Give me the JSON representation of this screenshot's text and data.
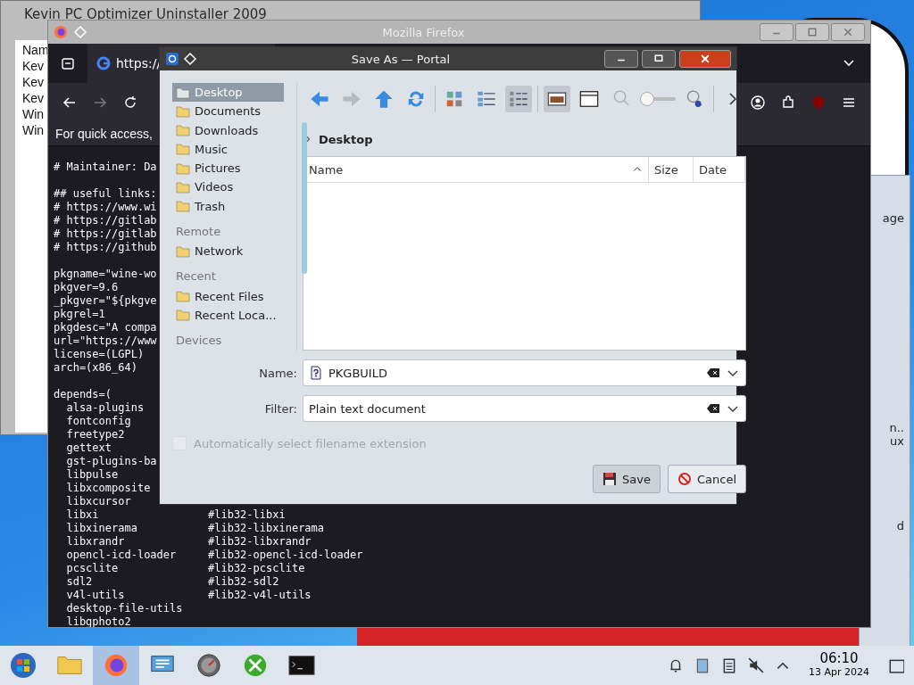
{
  "back_window": {
    "title": "Kevin PC Optimizer Uninstaller 2009",
    "list_items": [
      "Nam",
      "Kev",
      "Kev",
      "Kev",
      "Win",
      "Win"
    ]
  },
  "browser": {
    "title": "Mozilla Firefox",
    "tabs": [
      {
        "label": "https://",
        "selected": true
      }
    ],
    "notification": "For quick access,",
    "code_blocks": [
      [
        {
          "text": "# Maintainer: Da"
        }
      ],
      [
        {
          "text": "## useful links:"
        },
        {
          "text": "# https://www.wi"
        },
        {
          "text": "# https://gitlab"
        },
        {
          "text": "# https://gitlab"
        },
        {
          "text": "# https://github"
        }
      ],
      [
        {
          "text": "pkgname=\"wine-wo"
        },
        {
          "text": "pkgver=9.6"
        },
        {
          "text": "_pkgver=\"${pkgve"
        },
        {
          "text": "pkgrel=1"
        },
        {
          "text": "pkgdesc=\"A compa"
        },
        {
          "text": "url=\"https://www"
        },
        {
          "text": "license=(LGPL)"
        },
        {
          "text": "arch=(x86_64)"
        }
      ],
      [
        {
          "text": "depends=("
        },
        {
          "text": "  alsa-plugins"
        },
        {
          "text": "  fontconfig"
        },
        {
          "text": "  freetype2"
        },
        {
          "text": "  gettext"
        },
        {
          "text": "  gst-plugins-ba"
        },
        {
          "text": "  libpulse"
        },
        {
          "text": "  libxcomposite"
        },
        {
          "text": "  libxcursor"
        },
        {
          "text": "  libxi",
          "comment": "#lib32-libxi"
        },
        {
          "text": "  libxinerama",
          "comment": "#lib32-libxinerama"
        },
        {
          "text": "  libxrandr",
          "comment": "#lib32-libxrandr"
        },
        {
          "text": "  opencl-icd-loader",
          "comment": "#lib32-opencl-icd-loader"
        },
        {
          "text": "  pcsclite",
          "comment": "#lib32-pcsclite"
        },
        {
          "text": "  sdl2",
          "comment": "#lib32-sdl2"
        },
        {
          "text": "  v4l-utils",
          "comment": "#lib32-v4l-utils"
        },
        {
          "text": "  desktop-file-utils"
        },
        {
          "text": "  libgphoto2"
        }
      ]
    ]
  },
  "side_window": {
    "texts": [
      "age",
      "n..",
      "ux",
      "d"
    ]
  },
  "dialog": {
    "title": "Save As — Portal",
    "places": [
      {
        "kind": "item",
        "label": "Desktop",
        "selected": true
      },
      {
        "kind": "item",
        "label": "Documents",
        "selected": false
      },
      {
        "kind": "item",
        "label": "Downloads",
        "selected": false
      },
      {
        "kind": "item",
        "label": "Music",
        "selected": false
      },
      {
        "kind": "item",
        "label": "Pictures",
        "selected": false
      },
      {
        "kind": "item",
        "label": "Videos",
        "selected": false
      },
      {
        "kind": "item",
        "label": "Trash",
        "selected": false
      },
      {
        "kind": "header",
        "label": "Remote"
      },
      {
        "kind": "item",
        "label": "Network",
        "selected": false
      },
      {
        "kind": "header",
        "label": "Recent"
      },
      {
        "kind": "item",
        "label": "Recent Files",
        "selected": false
      },
      {
        "kind": "item",
        "label": "Recent Loca...",
        "selected": false
      },
      {
        "kind": "header",
        "label": "Devices"
      }
    ],
    "view_buttons": [
      {
        "kind": "icons",
        "selected": false
      },
      {
        "kind": "compact",
        "selected": false
      },
      {
        "kind": "detailed",
        "selected": true
      }
    ],
    "panel_buttons": [
      {
        "kind": "preview",
        "selected": true
      },
      {
        "kind": "places",
        "selected": false
      }
    ],
    "zoom_slider": {
      "level": 0
    },
    "breadcrumb": "Desktop",
    "columns": [
      {
        "label": "Name",
        "sorted": true
      },
      {
        "label": "Size",
        "sorted": false
      },
      {
        "label": "Date",
        "sorted": false
      }
    ],
    "name_label": "Name:",
    "name_value": "PKGBUILD",
    "filter_label": "Filter:",
    "filter_value": "Plain text document",
    "auto_extension": {
      "label": "Automatically select filename extension",
      "checked": false,
      "disabled": true
    },
    "buttons": [
      {
        "kind": "save",
        "label": "Save",
        "selected": true
      },
      {
        "kind": "cancel",
        "label": "Cancel",
        "selected": false
      }
    ]
  },
  "taskbar": {
    "apps": [
      {
        "kind": "files",
        "selected": false
      },
      {
        "kind": "firefox",
        "selected": true
      },
      {
        "kind": "settings",
        "selected": false
      },
      {
        "kind": "gauge",
        "selected": false
      },
      {
        "kind": "tools",
        "selected": false
      },
      {
        "kind": "terminal",
        "selected": false
      }
    ],
    "time": "06:10",
    "date": "13 Apr 2024"
  }
}
